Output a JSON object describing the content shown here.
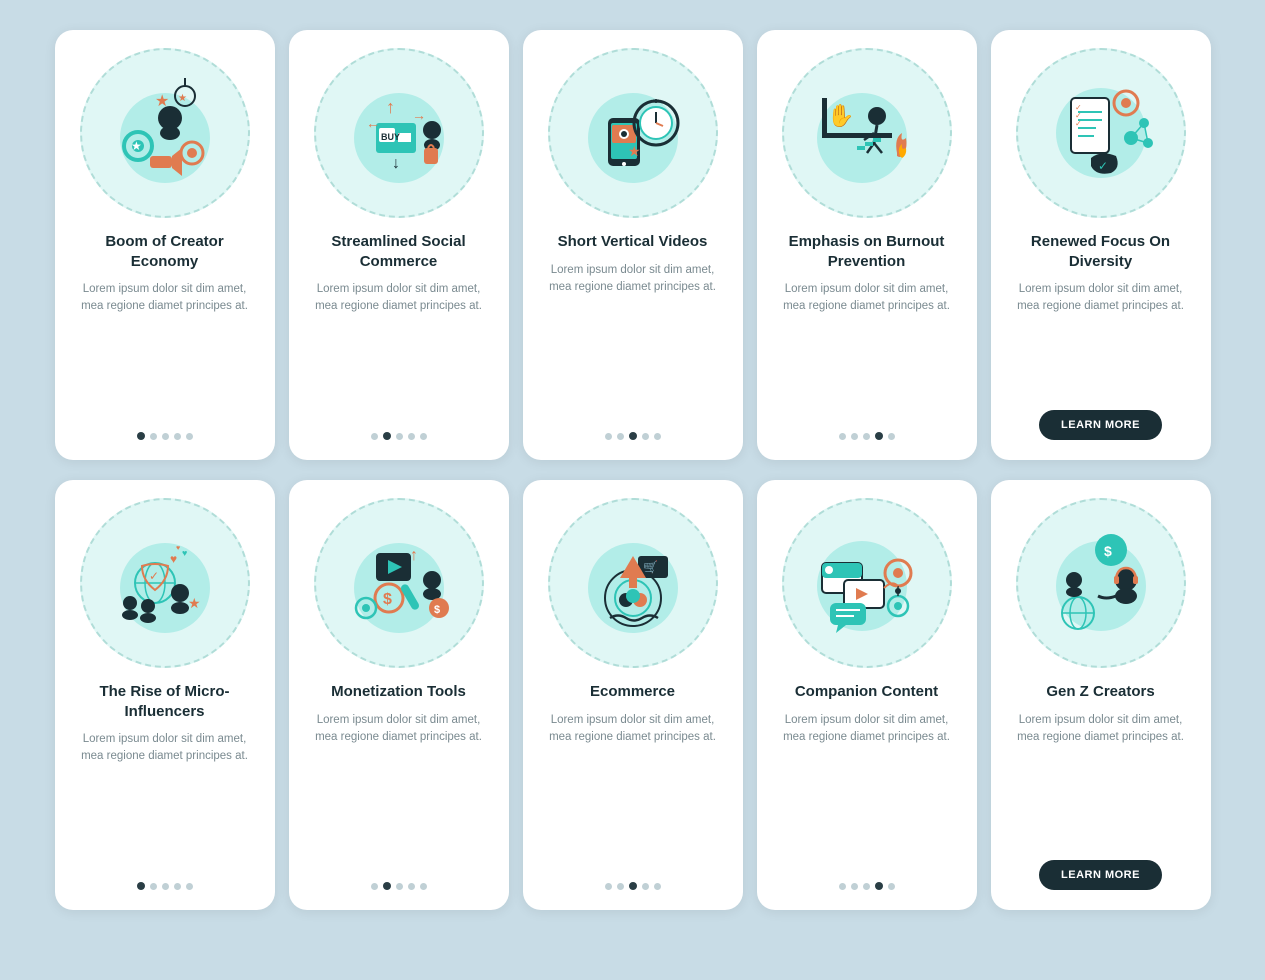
{
  "cards": [
    {
      "id": "creator-economy",
      "title": "Boom of Creator Economy",
      "text": "Lorem ipsum dolor sit dim amet, mea regione diamet principes at.",
      "dots": [
        1,
        2,
        3,
        4,
        5
      ],
      "active_dot": 1,
      "has_button": false,
      "icon": "creator"
    },
    {
      "id": "social-commerce",
      "title": "Streamlined Social Commerce",
      "text": "Lorem ipsum dolor sit dim amet, mea regione diamet principes at.",
      "dots": [
        1,
        2,
        3,
        4,
        5
      ],
      "active_dot": 2,
      "has_button": false,
      "icon": "social-commerce"
    },
    {
      "id": "short-videos",
      "title": "Short Vertical Videos",
      "text": "Lorem ipsum dolor sit dim amet, mea regione diamet principes at.",
      "dots": [
        1,
        2,
        3,
        4,
        5
      ],
      "active_dot": 3,
      "has_button": false,
      "icon": "short-videos"
    },
    {
      "id": "burnout",
      "title": "Emphasis on Burnout Prevention",
      "text": "Lorem ipsum dolor sit dim amet, mea regione diamet principes at.",
      "dots": [
        1,
        2,
        3,
        4,
        5
      ],
      "active_dot": 4,
      "has_button": false,
      "icon": "burnout"
    },
    {
      "id": "diversity",
      "title": "Renewed Focus On Diversity",
      "text": "Lorem ipsum dolor sit dim amet, mea regione diamet principes at.",
      "dots": [],
      "active_dot": 0,
      "has_button": true,
      "button_label": "LEARN MORE",
      "icon": "diversity"
    },
    {
      "id": "micro-influencers",
      "title": "The Rise of Micro-Influencers",
      "text": "Lorem ipsum dolor sit dim amet, mea regione diamet principes at.",
      "dots": [
        1,
        2,
        3,
        4,
        5
      ],
      "active_dot": 1,
      "has_button": false,
      "icon": "micro"
    },
    {
      "id": "monetization",
      "title": "Monetization Tools",
      "text": "Lorem ipsum dolor sit dim amet, mea regione diamet principes at.",
      "dots": [
        1,
        2,
        3,
        4,
        5
      ],
      "active_dot": 2,
      "has_button": false,
      "icon": "monetization"
    },
    {
      "id": "ecommerce",
      "title": "Ecommerce",
      "text": "Lorem ipsum dolor sit dim amet, mea regione diamet principes at.",
      "dots": [
        1,
        2,
        3,
        4,
        5
      ],
      "active_dot": 3,
      "has_button": false,
      "icon": "ecommerce"
    },
    {
      "id": "companion",
      "title": "Companion Content",
      "text": "Lorem ipsum dolor sit dim amet, mea regione diamet principes at.",
      "dots": [
        1,
        2,
        3,
        4,
        5
      ],
      "active_dot": 4,
      "has_button": false,
      "icon": "companion"
    },
    {
      "id": "genz",
      "title": "Gen Z Creators",
      "text": "Lorem ipsum dolor sit dim amet, mea regione diamet principes at.",
      "dots": [],
      "active_dot": 0,
      "has_button": true,
      "button_label": "LEARN MORE",
      "icon": "genz"
    }
  ]
}
